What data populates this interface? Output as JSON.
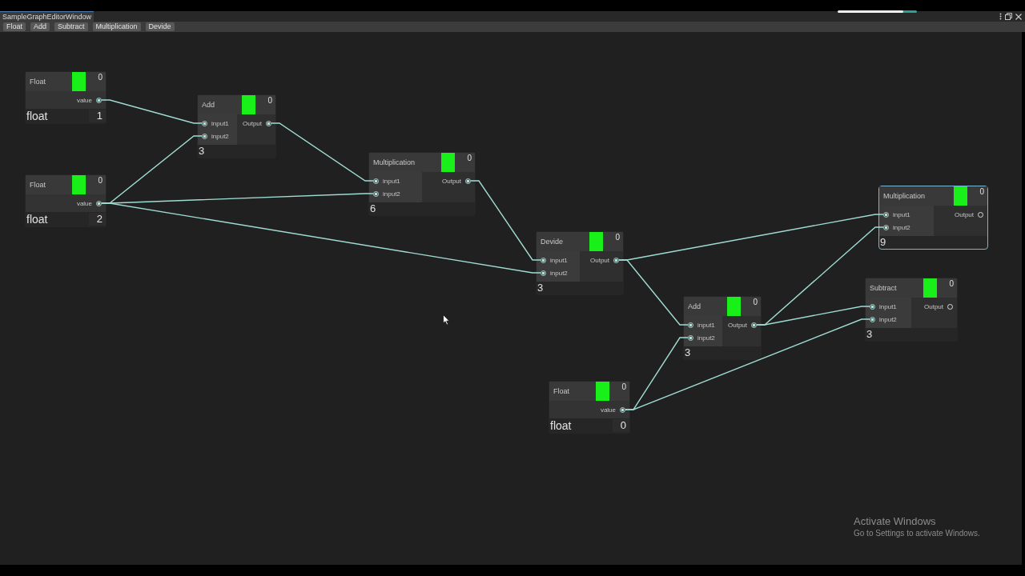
{
  "window": {
    "tab_title": "SampleGraphEditorWindow"
  },
  "progress_bar": {
    "level": 0.83
  },
  "toolbar_buttons": [
    "Float",
    "Add",
    "Subtract",
    "Multiplication",
    "Devide"
  ],
  "nodes": [
    {
      "kind": "float",
      "title": "Float",
      "count": "0",
      "selected": false,
      "outputs": [
        {
          "label": "value",
          "connected": true
        }
      ],
      "type_label": "float",
      "value": "1"
    },
    {
      "kind": "operation",
      "title": "Add",
      "count": "0",
      "selected": false,
      "inputs": [
        {
          "label": "input1",
          "connected": true
        },
        {
          "label": "input2",
          "connected": true
        }
      ],
      "outputs": [
        {
          "label": "Output",
          "connected": true
        }
      ],
      "result": "3"
    },
    {
      "kind": "operation",
      "title": "Multiplication",
      "count": "0",
      "selected": false,
      "inputs": [
        {
          "label": "input1",
          "connected": true
        },
        {
          "label": "input2",
          "connected": true
        }
      ],
      "outputs": [
        {
          "label": "Output",
          "connected": true
        }
      ],
      "result": "6"
    },
    {
      "kind": "float",
      "title": "Float",
      "count": "0",
      "selected": false,
      "outputs": [
        {
          "label": "value",
          "connected": true
        }
      ],
      "type_label": "float",
      "value": "2"
    },
    {
      "kind": "operation",
      "title": "Multiplication",
      "count": "0",
      "selected": true,
      "inputs": [
        {
          "label": "input1",
          "connected": true
        },
        {
          "label": "input2",
          "connected": true
        }
      ],
      "outputs": [
        {
          "label": "Output",
          "connected": false
        }
      ],
      "result": "9"
    },
    {
      "kind": "operation",
      "title": "Devide",
      "count": "0",
      "selected": false,
      "inputs": [
        {
          "label": "input1",
          "connected": true
        },
        {
          "label": "input2",
          "connected": true
        }
      ],
      "outputs": [
        {
          "label": "Output",
          "connected": true
        }
      ],
      "result": "3"
    },
    {
      "kind": "operation",
      "title": "Subtract",
      "count": "0",
      "selected": false,
      "inputs": [
        {
          "label": "input1",
          "connected": true
        },
        {
          "label": "input2",
          "connected": true
        }
      ],
      "outputs": [
        {
          "label": "Output",
          "connected": false
        }
      ],
      "result": "3"
    },
    {
      "kind": "operation",
      "title": "Add",
      "count": "0",
      "selected": false,
      "inputs": [
        {
          "label": "input1",
          "connected": true
        },
        {
          "label": "input2",
          "connected": true
        }
      ],
      "outputs": [
        {
          "label": "Output",
          "connected": true
        }
      ],
      "result": "3"
    },
    {
      "kind": "float",
      "title": "Float",
      "count": "0",
      "selected": false,
      "outputs": [
        {
          "label": "value",
          "connected": true
        }
      ],
      "type_label": "float",
      "value": "0"
    }
  ],
  "system_notice": {
    "title": "Activate Windows",
    "text": "Go to Settings to activate Windows."
  }
}
